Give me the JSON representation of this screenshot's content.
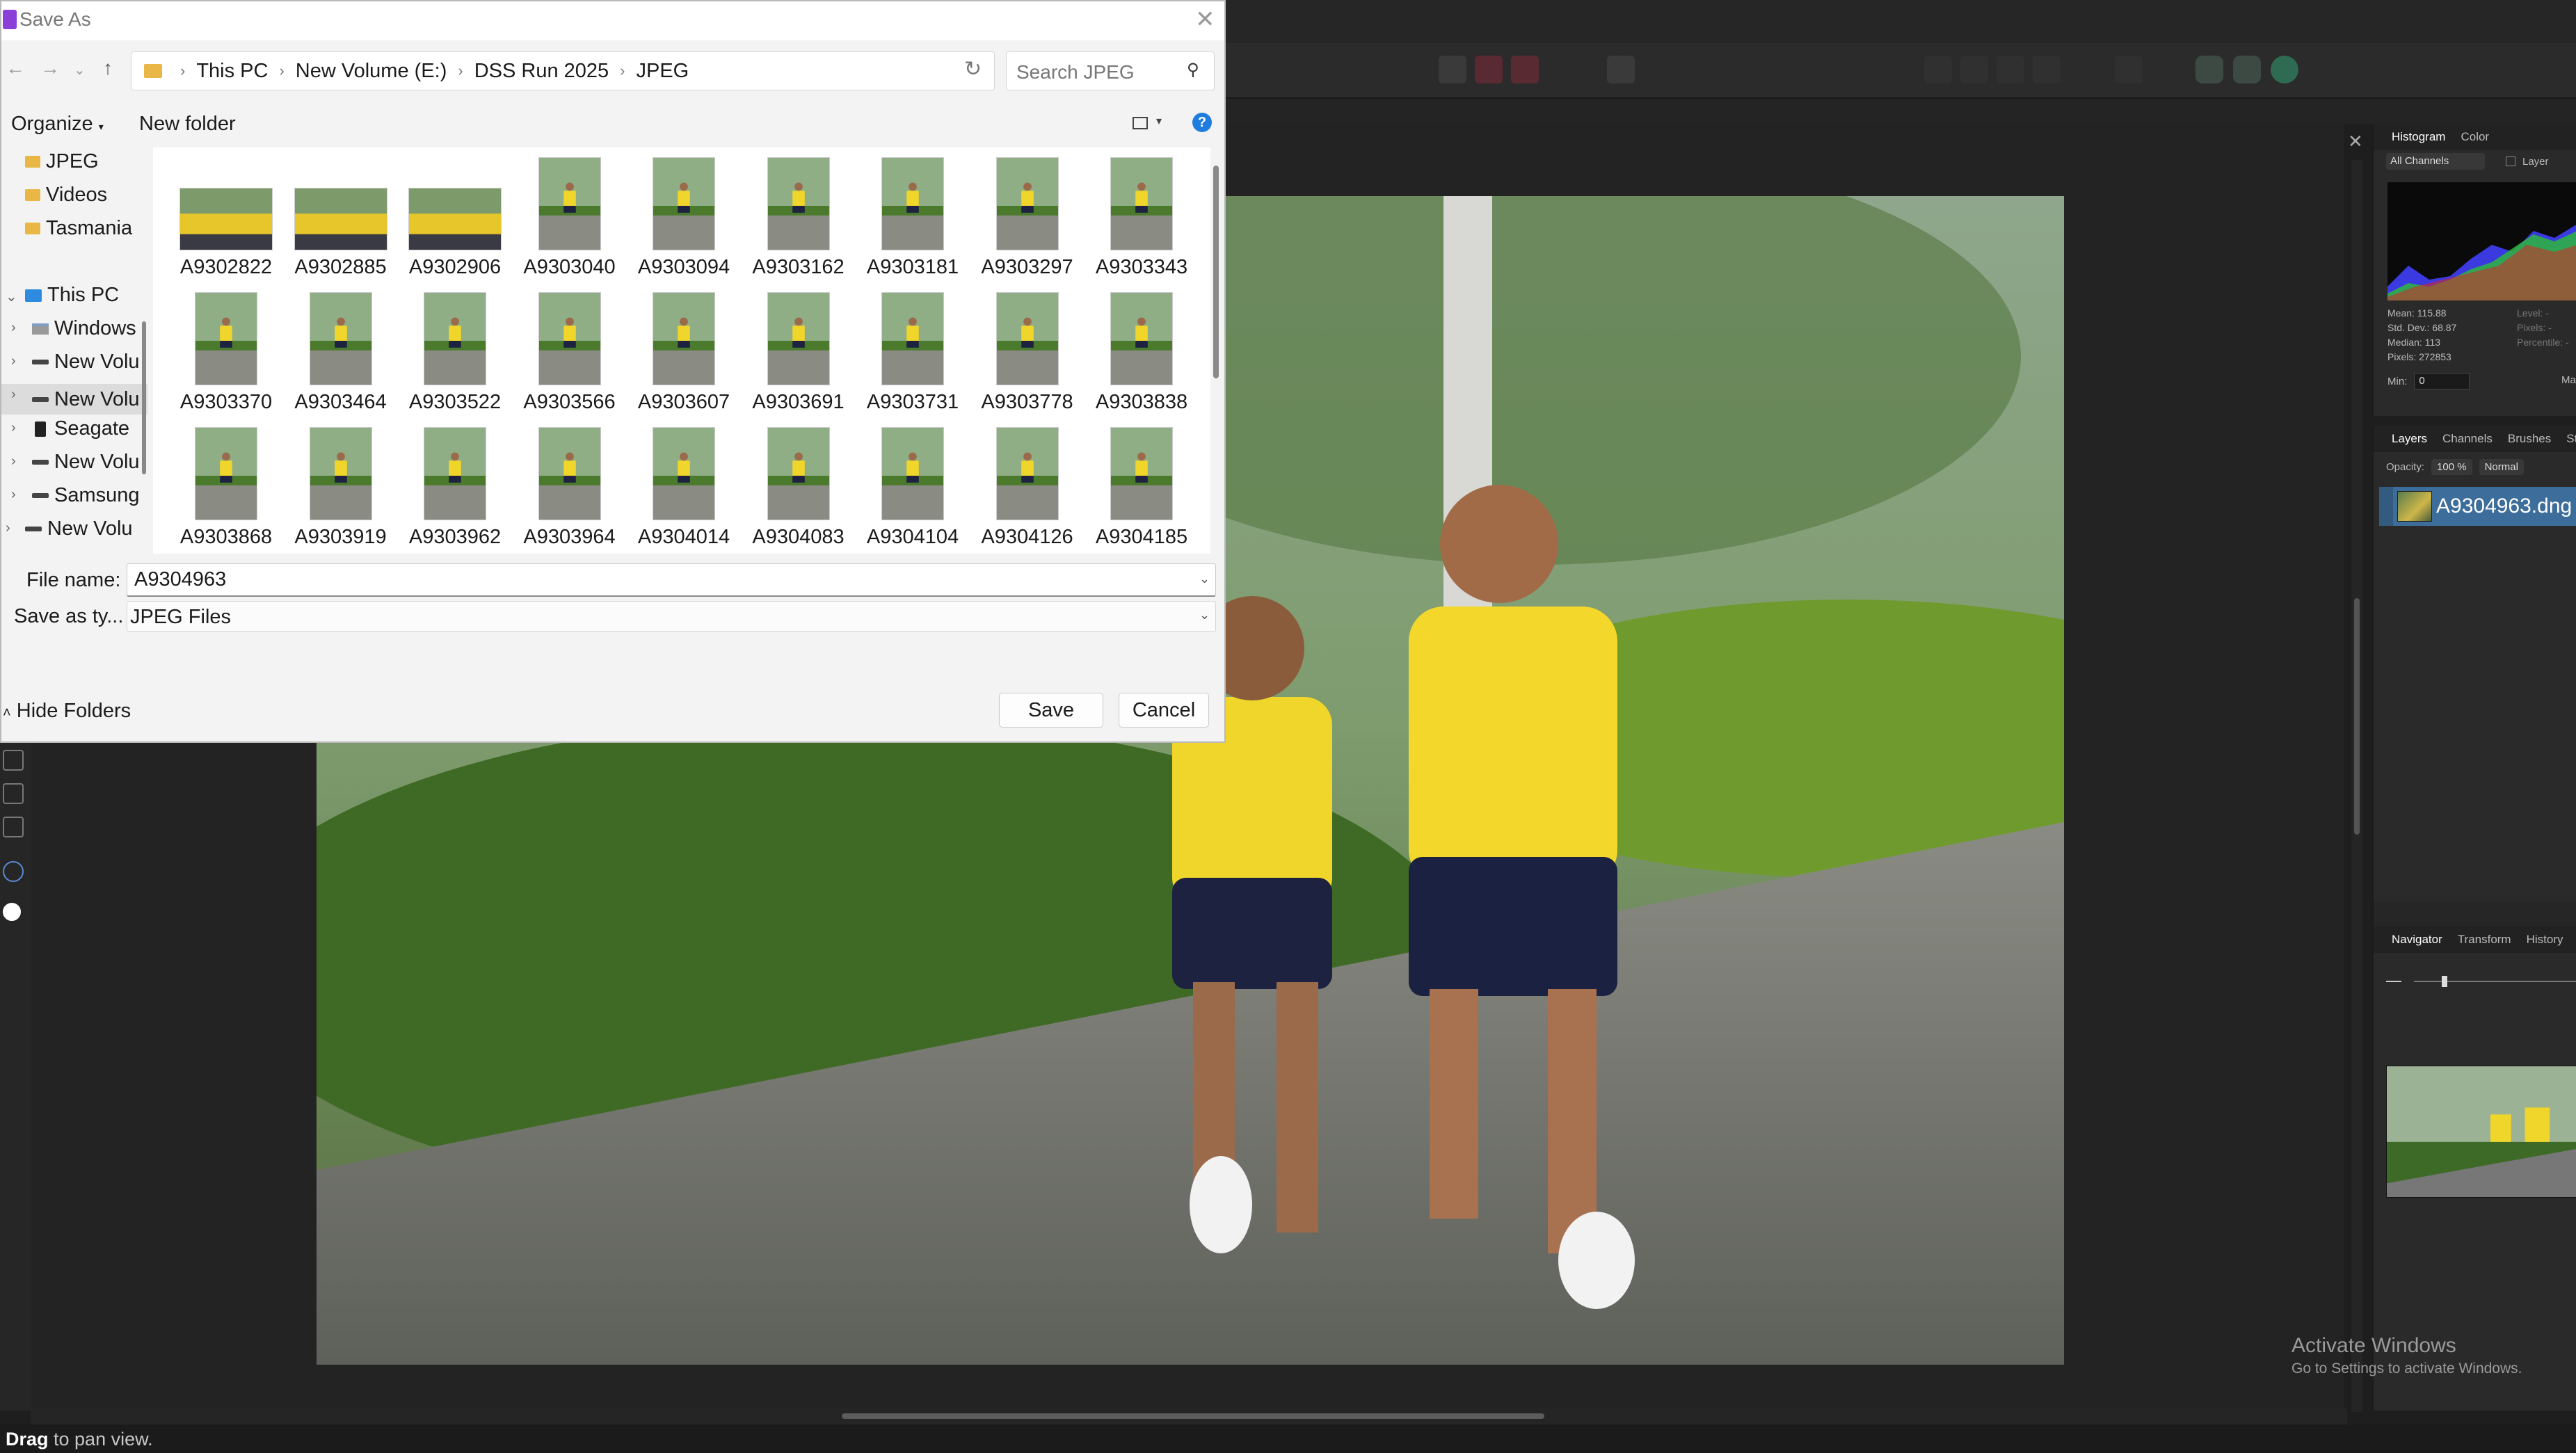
{
  "editor": {
    "status_prefix": "Drag",
    "status_rest": " to pan view.",
    "watermark_title": "Activate Windows",
    "watermark_sub": "Go to Settings to activate Windows."
  },
  "panels": {
    "histogram_tabs": [
      "Histogram",
      "Color"
    ],
    "histogram_channel": "All Channels",
    "histogram_layer_check": "Layer",
    "stats": [
      "Mean: 115.88",
      "Std. Dev.: 68.87",
      "Median: 113",
      "Pixels: 272853"
    ],
    "stats_right": [
      "Level: -",
      "Pixels: -",
      "Percentile: -"
    ],
    "min_label": "Min:",
    "min_value": "0",
    "max_label": "Ma",
    "layers_tabs": [
      "Layers",
      "Channels",
      "Brushes",
      "Stock"
    ],
    "opacity_label": "Opacity:",
    "opacity_value": "100 %",
    "blend_mode": "Normal",
    "layer_name": "A9304963.dng",
    "nav_tabs": [
      "Navigator",
      "Transform",
      "History"
    ]
  },
  "dialog": {
    "title": "Save As",
    "breadcrumbs": [
      "This PC",
      "New Volume (E:)",
      "DSS Run 2025",
      "JPEG"
    ],
    "search_placeholder": "Search JPEG",
    "organize": "Organize",
    "new_folder": "New folder",
    "help": "?",
    "nav_items": [
      "JPEG",
      "Videos",
      "Tasmania",
      "This PC",
      "Windows",
      "New Volu",
      "New Volu",
      "Seagate",
      "New Volu",
      "Samsung",
      "New Volu"
    ],
    "files": [
      "A9302822",
      "A9302885",
      "A9302906",
      "A9303040",
      "A9303094",
      "A9303162",
      "A9303181",
      "A9303297",
      "A9303343",
      "A9303370",
      "A9303464",
      "A9303522",
      "A9303566",
      "A9303607",
      "A9303691",
      "A9303731",
      "A9303778",
      "A9303838",
      "A9303868",
      "A9303919",
      "A9303962",
      "A9303964",
      "A9304014",
      "A9304083",
      "A9304104",
      "A9304126",
      "A9304185"
    ],
    "file_name_label": "File name:",
    "file_name_value": "A9304963",
    "save_type_label": "Save as ty...",
    "save_type_value": "JPEG Files",
    "hide_folders": "Hide Folders",
    "save": "Save",
    "cancel": "Cancel"
  }
}
